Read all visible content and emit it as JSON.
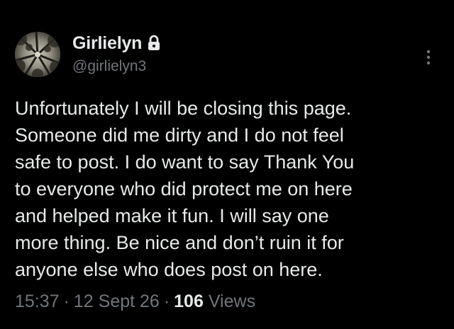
{
  "author": {
    "display_name": "Girlielyn",
    "handle": "@girlielyn3",
    "protected_icon": "lock-icon",
    "avatar_icon": "forest-canopy-avatar"
  },
  "tweet": {
    "lines": [
      "Unfortunately I will be closing this page.",
      "Someone did me dirty and I do not feel",
      "safe to post.  I do want to say Thank You",
      "to everyone who did protect me on here",
      "and helped make it fun.  I will say one",
      "more thing. Be nice and don’t ruin it for",
      "anyone else who does post on here."
    ]
  },
  "meta": {
    "time": "15:37",
    "date": "12 Sept 26",
    "separator": "·",
    "views_count": "106",
    "views_label": "Views"
  },
  "more_icon": "more-vertical-icon",
  "colors": {
    "background": "#000000",
    "primary_text": "#e7e9ea",
    "secondary_text": "#71767b"
  }
}
